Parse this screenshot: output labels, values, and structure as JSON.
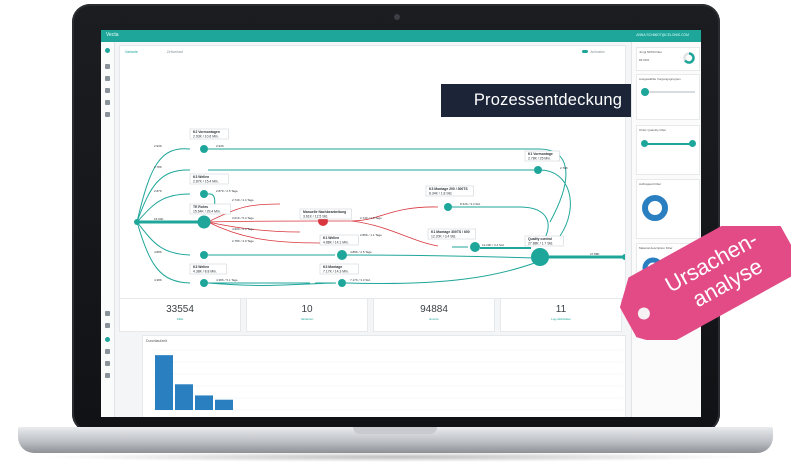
{
  "app": {
    "brand": "Vecta",
    "user": "ANNA SCHMIDT@CELONIS.COM"
  },
  "overlay": {
    "banner": "Prozessentdeckung",
    "tag_line1": "Ursachen-",
    "tag_line2": "analyse"
  },
  "tabs": [
    {
      "label": "Variante"
    },
    {
      "label": "Zeitverlauf"
    }
  ],
  "toggle_label": "Animation",
  "process": {
    "activities": [
      {
        "title": "K2 Vormontagen",
        "sub": "2.93K / 10.6 Min."
      },
      {
        "title": "K3 Wellen",
        "sub": "2.87K / 15.4 Min."
      },
      {
        "title": "TE Rohrs",
        "sub": "15.64K / 29.4 Min."
      },
      {
        "title": "Manuelle Nachbearbeitung",
        "sub": "3.61K / 12.5 Std."
      },
      {
        "title": "K1 Wellen",
        "sub": "4.88K / 14.1 Min."
      },
      {
        "title": "K3 Montage",
        "sub": "7.17K / 14.3 Min."
      },
      {
        "title": "K3 Wellen",
        "sub": "4.38K / 8.8 Min."
      },
      {
        "title": "K3 Montage 200 / 300TS",
        "sub": "8.34K / 1.8 Std."
      },
      {
        "title": "K1 Montage 300TS / 600",
        "sub": "12.20K / 3.4 Std."
      },
      {
        "title": "K1 Vormontage",
        "sub": "2.78K / 25 Min."
      },
      {
        "title": "Quality control",
        "sub": "27.88K / 1.7 Std."
      }
    ],
    "edges": [
      "2.93K",
      "2.78K",
      "2.87K",
      "15.64K",
      "4.88K",
      "4.38K",
      "2.74K / 4.4 Tage",
      "3.61K / 5.4 Tage",
      "4.90K / 6.3 Tage",
      "2.78K / 4.0 Tage",
      "2.74K / 1.8 Tage",
      "2.88K / 1.1 Tage",
      "4.88K / 2.5 Tage",
      "7.17K / 3.3 Std.",
      "4.38K / 5.1 Tage",
      "2.87K / 2.5 Tage",
      "2.93K",
      "8.34K / 3.4 Std.",
      "12.20K / 3.4 Std.",
      "2.78K",
      "27.88K"
    ]
  },
  "right_panel": {
    "cards": [
      {
        "title": "Jungi 50/50 Filter",
        "sub": "83 66%"
      },
      {
        "title": "Ausgewählte Vorgangsgruppen"
      },
      {
        "title": "Order Quantity Filter"
      },
      {
        "title": "Auftragsart Filter"
      },
      {
        "title": "Material description Filter"
      }
    ]
  },
  "kpis": [
    {
      "value": "33554",
      "label": "Fälle"
    },
    {
      "value": "10",
      "label": "Varianten"
    },
    {
      "value": "94884",
      "label": "Events"
    },
    {
      "value": "11",
      "label": "Log-Aktivitäten"
    }
  ],
  "throughput": {
    "title": "Durchlaufzeit",
    "bars": [
      32,
      15,
      8.5,
      6
    ]
  },
  "colors": {
    "teal": "#1fa69a",
    "red": "#d9363e",
    "navy": "#1c2538",
    "pink": "#e24b86"
  }
}
